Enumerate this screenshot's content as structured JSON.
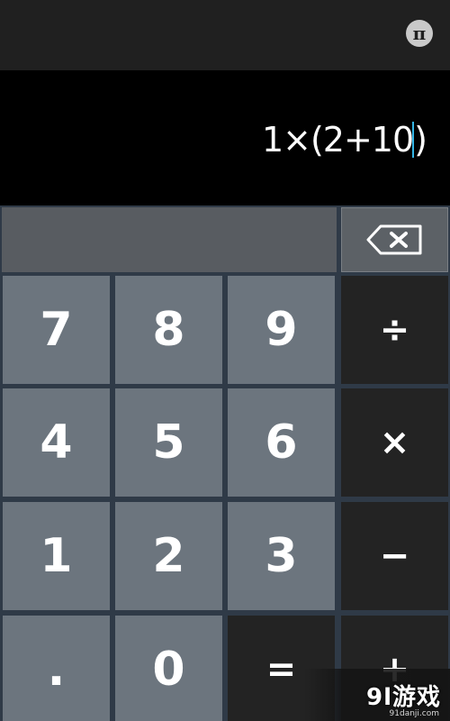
{
  "topbar": {
    "pi_label": "π"
  },
  "display": {
    "expression_before_cursor": "1×(2+10",
    "expression_after_cursor": ")"
  },
  "keys": {
    "seven": "7",
    "eight": "8",
    "nine": "9",
    "divide": "÷",
    "four": "4",
    "five": "5",
    "six": "6",
    "multiply": "×",
    "one": "1",
    "two": "2",
    "three": "3",
    "minus": "−",
    "dot": ".",
    "zero": "0",
    "equals": "=",
    "plus": "+"
  },
  "watermark": {
    "logo": "9l游戏",
    "url": "91danji.com"
  },
  "colors": {
    "topbar": "#202020",
    "display": "#000000",
    "number_key": "#6c757e",
    "operator_key": "#232323",
    "cursor": "#33b5e5"
  }
}
